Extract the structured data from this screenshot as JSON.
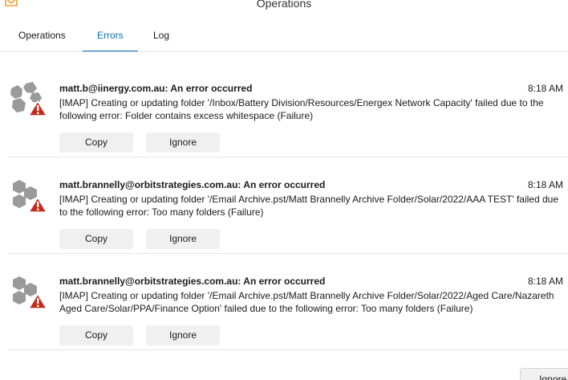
{
  "window": {
    "title": "Operations",
    "logo_icon": "mail-app-icon"
  },
  "tabs": [
    {
      "label": "Operations",
      "active": false
    },
    {
      "label": "Errors",
      "active": true
    },
    {
      "label": "Log",
      "active": false
    }
  ],
  "errors": [
    {
      "account": "matt.b@iinergy.com.au: An error occurred",
      "time": "8:18 AM",
      "message": "[IMAP] Creating or updating folder '/Inbox/Battery Division/Resources/Energex  Network Capacity' failed due to the following error:  Folder contains excess whitespace (Failure)",
      "copy_label": "Copy",
      "ignore_label": "Ignore",
      "icon": "account-error-icon"
    },
    {
      "account": "matt.brannelly@orbitstrategies.com.au: An error occurred",
      "time": "8:18 AM",
      "message": "[IMAP] Creating or updating folder '/Email Archive.pst/Matt Brannelly Archive Folder/Solar/2022/AAA TEST' failed due to the following error: Too many folders (Failure)",
      "copy_label": "Copy",
      "ignore_label": "Ignore",
      "icon": "account-error-icon"
    },
    {
      "account": "matt.brannelly@orbitstrategies.com.au: An error occurred",
      "time": "8:18 AM",
      "message": "[IMAP] Creating or updating folder '/Email Archive.pst/Matt Brannelly Archive Folder/Solar/2022/Aged Care/Nazareth Aged Care/Solar/PPA/Finance Option' failed due to the following error: Too many folders (Failure)",
      "copy_label": "Copy",
      "ignore_label": "Ignore",
      "icon": "account-error-icon"
    }
  ],
  "footer": {
    "ignore_all_label": "Ignore A"
  },
  "colors": {
    "accent": "#0f6cbd",
    "error_badge": "#c42b1c",
    "icon_gray": "#9a9a9a"
  }
}
